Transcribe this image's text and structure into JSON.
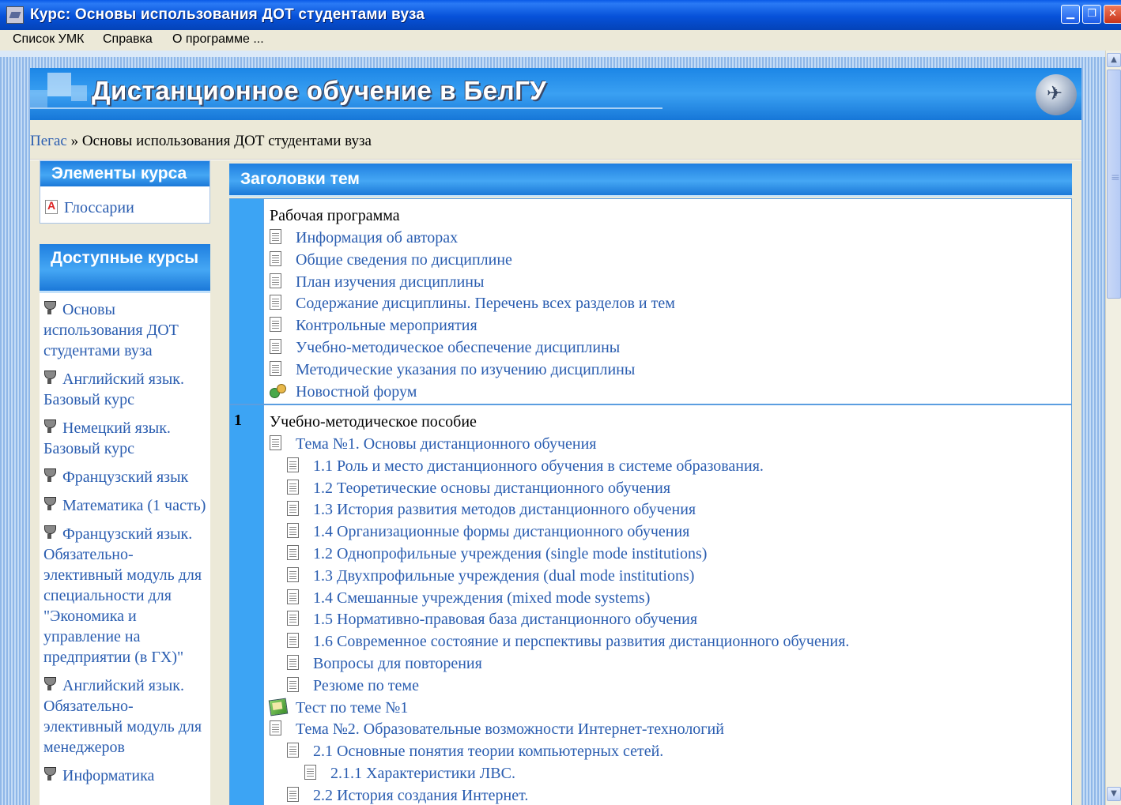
{
  "window": {
    "title": "Курс: Основы использования ДОТ студентами вуза",
    "min_glyph": "▁",
    "max_glyph": "❐",
    "close_glyph": "✕"
  },
  "menu": [
    "Список УМК",
    "Справка",
    "О программе ..."
  ],
  "scrollbar": {
    "up_glyph": "▲",
    "down_glyph": "▼"
  },
  "banner": {
    "title": "Дистанционное обучение в БелГУ"
  },
  "breadcrumb": {
    "root": "Пегас",
    "separator": " » ",
    "current": "Основы использования ДОТ студентами вуза"
  },
  "left": {
    "elements_title": "Элементы курса",
    "glossary_label": "Глоссарии",
    "courses_title": "Доступные курсы",
    "courses": [
      "Основы использования ДОТ студентами вуза",
      "Английский язык. Базовый курс",
      "Немецкий язык. Базовый курс",
      "Французский язык",
      "Математика (1 часть)",
      "Французский язык. Обязательно-элективный модуль для специальности для \"Экономика и управление на предприятии (в ГХ)\"",
      "Английский язык. Обязательно-элективный модуль для менеджеров",
      "Информатика"
    ]
  },
  "main": {
    "title": "Заголовки тем",
    "section0": {
      "number": "",
      "title": "Рабочая программа",
      "items": [
        {
          "label": "Информация об авторах",
          "icon": "document-icon"
        },
        {
          "label": "Общие сведения по дисциплине",
          "icon": "document-icon"
        },
        {
          "label": "План изучения дисциплины",
          "icon": "document-icon"
        },
        {
          "label": "Содержание дисциплины. Перечень всех разделов и тем",
          "icon": "document-icon"
        },
        {
          "label": "Контрольные мероприятия",
          "icon": "document-icon"
        },
        {
          "label": "Учебно-методическое обеспечение дисциплины",
          "icon": "document-icon"
        },
        {
          "label": "Методические указания по изучению дисциплины",
          "icon": "document-icon"
        },
        {
          "label": "Новостной форум",
          "icon": "forum-icon"
        }
      ]
    },
    "section1": {
      "number": "1",
      "title": "Учебно-методическое пособие",
      "items": [
        {
          "label": "Тема №1. Основы дистанционного обучения",
          "icon": "document-icon",
          "level": 0
        },
        {
          "label": "1.1 Роль и место дистанционного обучения в системе образования.",
          "icon": "document-icon",
          "level": 1
        },
        {
          "label": "1.2 Теоретические основы дистанционного обучения",
          "icon": "document-icon",
          "level": 1
        },
        {
          "label": "1.3 История развития методов дистанционного обучения",
          "icon": "document-icon",
          "level": 1
        },
        {
          "label": "1.4 Организационные формы дистанционного обучения",
          "icon": "document-icon",
          "level": 1
        },
        {
          "label": "1.2 Однопрофильные учреждения (single mode institutions)",
          "icon": "document-icon",
          "level": 1
        },
        {
          "label": "1.3 Двухпрофильные учреждения (dual mode institutions)",
          "icon": "document-icon",
          "level": 1
        },
        {
          "label": "1.4 Смешанные учреждения (mixed mode systems)",
          "icon": "document-icon",
          "level": 1
        },
        {
          "label": "1.5 Нормативно-правовая база дистанционного обучения",
          "icon": "document-icon",
          "level": 1
        },
        {
          "label": "1.6 Современное состояние и перспективы развития дистанционного обучения.",
          "icon": "document-icon",
          "level": 1
        },
        {
          "label": "Вопросы для повторения",
          "icon": "document-icon",
          "level": 1
        },
        {
          "label": "Резюме по теме",
          "icon": "document-icon",
          "level": 1
        },
        {
          "label": "Тест по теме №1",
          "icon": "quiz-icon",
          "level": 0
        },
        {
          "label": "Тема №2.  Образовательные возможности Интернет-технологий",
          "icon": "document-icon",
          "level": 0
        },
        {
          "label": "2.1 Основные понятия теории компьютерных сетей.",
          "icon": "document-icon",
          "level": 1
        },
        {
          "label": "2.1.1 Характеристики ЛВС.",
          "icon": "document-icon",
          "level": 2
        },
        {
          "label": "2.2 История создания Интернет.",
          "icon": "document-icon",
          "level": 1
        }
      ]
    }
  }
}
